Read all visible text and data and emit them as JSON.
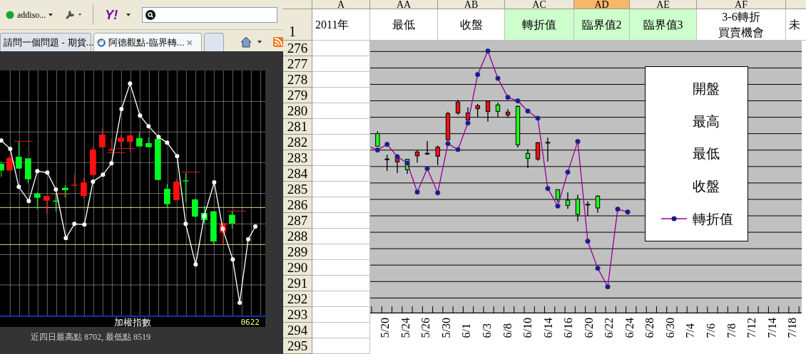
{
  "browser": {
    "toolbar": {
      "profile_label": "addiso...",
      "logo_text": "Y!"
    },
    "tabs": [
      {
        "label": "請問一個問題 - 期貨...",
        "selected": false
      },
      {
        "label": "阿德觀點-臨界轉...",
        "selected": true
      }
    ]
  },
  "stock_chart": {
    "title": "加權指數",
    "code": "0622",
    "summary": "近四日最高點 8702, 最低點 8519"
  },
  "spreadsheet": {
    "columns": [
      {
        "label": "A",
        "selected": false
      },
      {
        "label": "AA",
        "selected": false
      },
      {
        "label": "AB",
        "selected": false
      },
      {
        "label": "AC",
        "selected": false
      },
      {
        "label": "AD",
        "selected": true
      },
      {
        "label": "AE",
        "selected": false
      },
      {
        "label": "AF",
        "selected": false
      }
    ],
    "row_1": {
      "label": "1",
      "cells": [
        {
          "text": "2011年",
          "highlighted": false
        },
        {
          "text": "最低",
          "highlighted": false
        },
        {
          "text": "收盤",
          "highlighted": false
        },
        {
          "text": "轉折值",
          "highlighted": true
        },
        {
          "text": "臨界值2",
          "highlighted": true
        },
        {
          "text": "臨界值3",
          "highlighted": true
        },
        {
          "text": "3-6轉折買賣機會",
          "highlighted": false
        },
        {
          "text": "未",
          "highlighted": false
        }
      ]
    },
    "rows": [
      "276",
      "277",
      "278",
      "279",
      "280",
      "281",
      "282",
      "283",
      "284",
      "285",
      "286",
      "287",
      "288",
      "289",
      "290",
      "291",
      "292",
      "293",
      "294",
      "295"
    ],
    "chart": {
      "legend": [
        {
          "label": "開盤",
          "kind": "text"
        },
        {
          "label": "最高",
          "kind": "text"
        },
        {
          "label": "最低",
          "kind": "text"
        },
        {
          "label": "收盤",
          "kind": "text"
        },
        {
          "label": "轉折值",
          "kind": "line"
        }
      ],
      "date_labels": [
        "5/20",
        "5/24",
        "5/26",
        "5/30",
        "6/1",
        "6/3",
        "6/8",
        "6/10",
        "6/14",
        "6/16",
        "6/20",
        "6/22",
        "6/24",
        "6/28",
        "6/30",
        "7/4",
        "7/6",
        "7/8",
        "7/12",
        "7/14",
        "7/18"
      ]
    }
  }
}
